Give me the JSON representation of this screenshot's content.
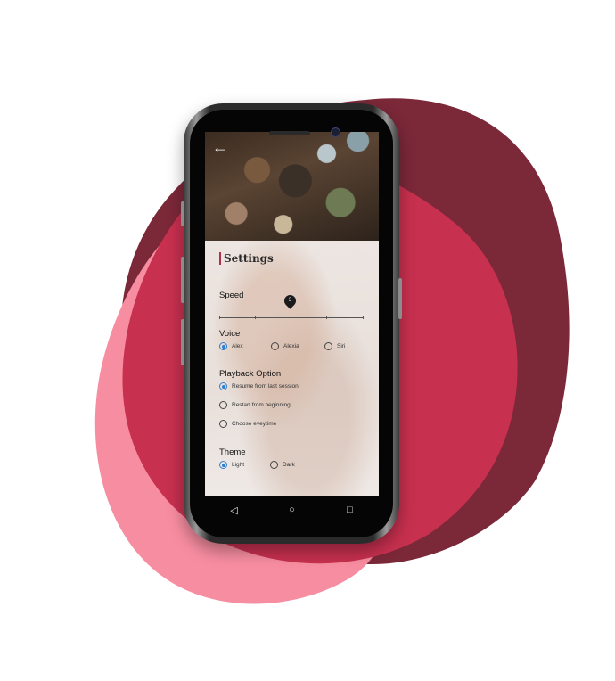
{
  "colors": {
    "blob_dark": "#7b2839",
    "blob_mid": "#c7304f",
    "blob_light": "#f78da0",
    "accent_radio": "#2f7fd0"
  },
  "app": {
    "back_icon": "arrow-left-icon",
    "back_glyph": "←",
    "title": "Settings",
    "speed": {
      "label": "Speed",
      "value": "3"
    },
    "voice": {
      "label": "Voice",
      "options": [
        "Alex",
        "Alexia",
        "Siri"
      ],
      "selected": "Alex"
    },
    "playback": {
      "label": "Playback Option",
      "options": [
        "Resume from last session",
        "Restart from beginning",
        "Choose eveytime"
      ],
      "selected": "Resume from last session"
    },
    "theme": {
      "label": "Theme",
      "options": [
        "Light",
        "Dark"
      ],
      "selected": "Light"
    }
  },
  "navbar": {
    "back_glyph": "◁",
    "home_glyph": "○",
    "recents_glyph": "□"
  }
}
